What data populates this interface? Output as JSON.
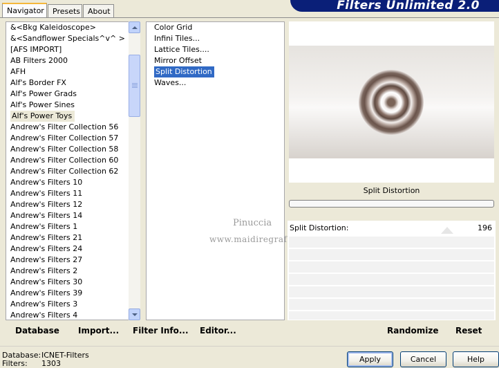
{
  "tabs": [
    {
      "label": "Navigator",
      "active": true
    },
    {
      "label": "Presets",
      "active": false
    },
    {
      "label": "About",
      "active": false
    }
  ],
  "banner": {
    "title": "Filters Unlimited 2.0"
  },
  "categories": [
    "&<Bkg Kaleidoscope>",
    "&<Sandflower Specials^v^ >",
    "[AFS IMPORT]",
    "AB Filters 2000",
    "AFH",
    "Alf's Border FX",
    "Alf's Power Grads",
    "Alf's Power Sines",
    "Alf's Power Toys",
    "Andrew's Filter Collection 56",
    "Andrew's Filter Collection 57",
    "Andrew's Filter Collection 58",
    "Andrew's Filter Collection 60",
    "Andrew's Filter Collection 62",
    "Andrew's Filters 10",
    "Andrew's Filters 11",
    "Andrew's Filters 12",
    "Andrew's Filters 14",
    "Andrew's Filters 1",
    "Andrew's Filters 21",
    "Andrew's Filters 24",
    "Andrew's Filters 27",
    "Andrew's Filters 2",
    "Andrew's Filters 30",
    "Andrew's Filters 39",
    "Andrew's Filters 3",
    "Andrew's Filters 4"
  ],
  "highlighted_category": "Alf's Power Toys",
  "filters": [
    "Color Grid",
    "Infini Tiles...",
    "Lattice Tiles....",
    "Mirror Offset",
    "Split Distortion",
    "Waves..."
  ],
  "selected_filter": "Split Distortion",
  "left_buttons": {
    "database": "Database",
    "import": "Import...",
    "filter_info": "Filter Info...",
    "editor": "Editor..."
  },
  "right_buttons": {
    "randomize": "Randomize",
    "reset": "Reset"
  },
  "filter_title": "Split Distortion",
  "parameters": [
    {
      "name": "Split Distortion:",
      "value": "196"
    }
  ],
  "watermark": {
    "line1": "Pinuccia",
    "line2": "www.maidiregrafica.eu"
  },
  "status": {
    "database_label": "Database:",
    "database_value": "ICNET-Filters",
    "filters_label": "Filters:",
    "filters_value": "1303"
  },
  "actions": {
    "apply": "Apply",
    "cancel": "Cancel",
    "help": "Help"
  },
  "colors": {
    "selection": "#316ac5",
    "banner": "#0a1f78",
    "face": "#ece9d8"
  }
}
